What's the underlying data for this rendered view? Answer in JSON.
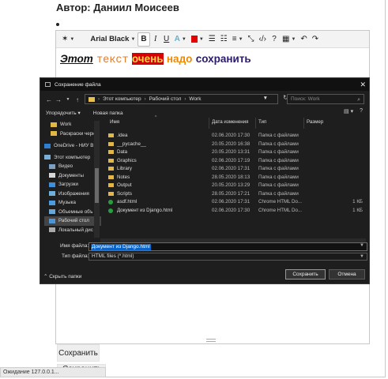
{
  "page": {
    "author_label": "Автор: Даниил Моисеев",
    "save_button": "Сохранить",
    "save_button_2": "Сохранить",
    "status_text": "Ожидание 127.0.0.1..."
  },
  "editor": {
    "toolbar": {
      "font_name": "Arial Black",
      "bold": "B",
      "italic": "I",
      "underline": "U",
      "font_color": "A"
    },
    "content_words": [
      "Этот",
      "текст",
      "очень",
      "надо",
      "сохранить"
    ]
  },
  "dialog": {
    "title": "Сохранение файла",
    "breadcrumb": [
      "Этот компьютер",
      "Рабочий стол",
      "Work"
    ],
    "search_placeholder": "Поиск: Work",
    "organize_label": "Упорядочить",
    "new_folder_label": "Новая папка",
    "tree": [
      {
        "label": "Work",
        "icon": "folder-icon"
      },
      {
        "label": "Раскраски черн",
        "icon": "folder-icon"
      },
      {
        "label": "OneDrive - НИУ В",
        "icon": "cloud-icon"
      },
      {
        "label": "Этот компьютер",
        "icon": "computer-icon"
      },
      {
        "label": "Видео",
        "icon": "video-icon"
      },
      {
        "label": "Документы",
        "icon": "document-icon"
      },
      {
        "label": "Загрузки",
        "icon": "download-icon"
      },
      {
        "label": "Изображения",
        "icon": "image-icon"
      },
      {
        "label": "Музыка",
        "icon": "music-icon"
      },
      {
        "label": "Объемные объ",
        "icon": "cube-icon"
      },
      {
        "label": "Рабочий стол",
        "icon": "desktop-icon",
        "selected": true
      },
      {
        "label": "Локальный дис",
        "icon": "drive-icon"
      }
    ],
    "columns": [
      "Имя",
      "Дата изменения",
      "Тип",
      "Размер"
    ],
    "files": [
      {
        "name": ".idea",
        "date": "02.06.2020 17:30",
        "type": "Папка с файлами",
        "size": "",
        "kind": "folder"
      },
      {
        "name": "__pycache__",
        "date": "20.05.2020 16:38",
        "type": "Папка с файлами",
        "size": "",
        "kind": "folder"
      },
      {
        "name": "Data",
        "date": "20.05.2020 13:31",
        "type": "Папка с файлами",
        "size": "",
        "kind": "folder"
      },
      {
        "name": "Graphics",
        "date": "02.06.2020 17:19",
        "type": "Папка с файлами",
        "size": "",
        "kind": "folder"
      },
      {
        "name": "Library",
        "date": "02.06.2020 17:31",
        "type": "Папка с файлами",
        "size": "",
        "kind": "folder"
      },
      {
        "name": "Notes",
        "date": "28.05.2020 18:13",
        "type": "Папка с файлами",
        "size": "",
        "kind": "folder"
      },
      {
        "name": "Output",
        "date": "20.05.2020 13:29",
        "type": "Папка с файлами",
        "size": "",
        "kind": "folder"
      },
      {
        "name": "Scripts",
        "date": "28.05.2020 17:21",
        "type": "Папка с файлами",
        "size": "",
        "kind": "folder"
      },
      {
        "name": "asdf.html",
        "date": "02.06.2020 17:31",
        "type": "Chrome HTML Do...",
        "size": "1 КБ",
        "kind": "html"
      },
      {
        "name": "Документ из Django.html",
        "date": "02.06.2020 17:30",
        "type": "Chrome HTML Do...",
        "size": "1 КБ",
        "kind": "html"
      }
    ],
    "filename_label": "Имя файла:",
    "filename_value": "Документ из Django.html",
    "filetype_label": "Тип файла:",
    "filetype_value": "HTML files (*.html)",
    "hide_folders_label": "Скрыть папки",
    "save_label": "Сохранить",
    "cancel_label": "Отмена"
  }
}
